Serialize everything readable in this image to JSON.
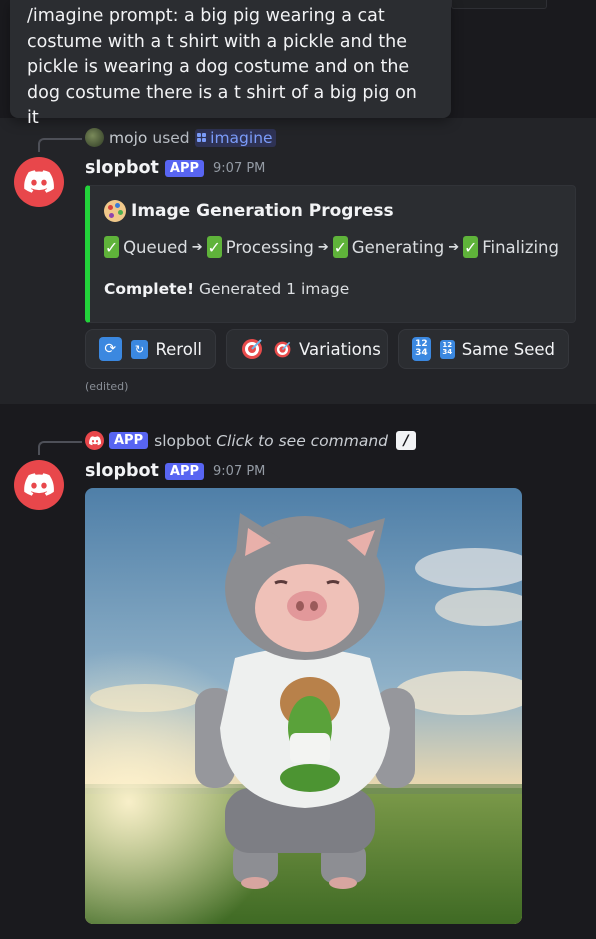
{
  "tooltip": {
    "text": "/imagine prompt: a big pig wearing a cat costume with a t shirt with a pickle and the pickle is wearing a dog costume and on the dog costume there is a t shirt of a big pig on it"
  },
  "message1": {
    "reference": {
      "user": "mojo",
      "verb": "used",
      "command": "imagine"
    },
    "author": "slopbot",
    "app_badge": "APP",
    "timestamp": "9:07 PM",
    "embed": {
      "title": "Image Generation Progress",
      "accent_color": "#22d33a",
      "steps": [
        "Queued",
        "Processing",
        "Generating",
        "Finalizing"
      ],
      "complete_bold": "Complete!",
      "complete_rest": " Generated 1 image"
    },
    "buttons": [
      {
        "label": "Reroll",
        "icon": "arrows-cycle-icon"
      },
      {
        "label": "Variations",
        "icon": "dart-icon"
      },
      {
        "label": "Same Seed",
        "icon": "numbers-icon"
      }
    ],
    "edited": "(edited)"
  },
  "message2": {
    "reference": {
      "app_badge": "APP",
      "name": "slopbot",
      "hint": "Click to see command"
    },
    "author": "slopbot",
    "app_badge": "APP",
    "timestamp": "9:07 PM",
    "image_alt": "pig in cat costume illustration"
  },
  "colors": {
    "brand": "#5865f2",
    "avatar": "#e8474b",
    "link": "#7b9cf9"
  }
}
